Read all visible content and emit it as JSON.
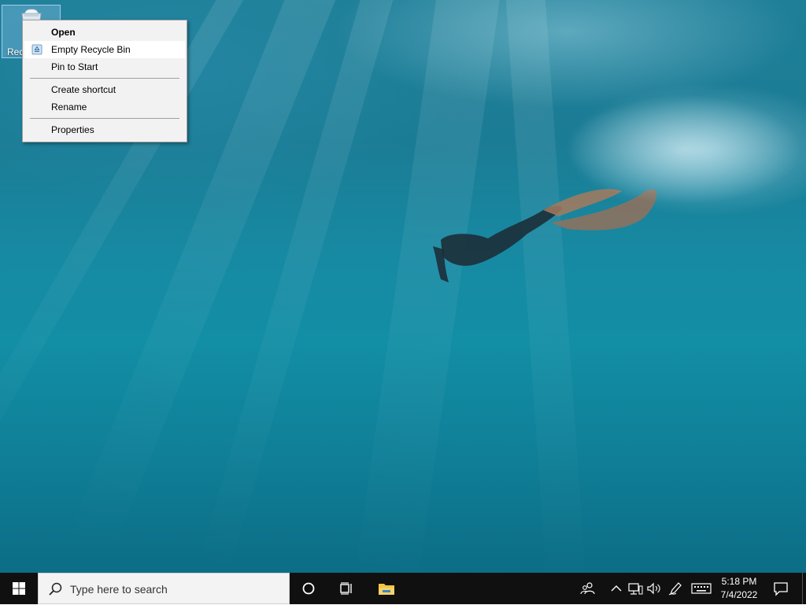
{
  "desktop": {
    "icons": [
      {
        "label": "Recycle Bin",
        "visible_label": "Rec",
        "icon": "recycle-bin-icon"
      }
    ]
  },
  "context_menu": {
    "items": [
      {
        "label": "Open",
        "bold": true
      },
      {
        "label": "Empty Recycle Bin",
        "icon": "recycle-icon",
        "highlighted": true
      },
      {
        "label": "Pin to Start"
      },
      {
        "label": "Create shortcut"
      },
      {
        "label": "Rename"
      },
      {
        "label": "Properties"
      }
    ]
  },
  "taskbar": {
    "start_icon": "windows-logo-icon",
    "search": {
      "placeholder": "Type here to search",
      "icon": "search-icon"
    },
    "buttons": [
      {
        "name": "cortana",
        "icon": "cortana-circle-icon"
      },
      {
        "name": "task-view",
        "icon": "task-view-icon"
      },
      {
        "name": "file-explorer",
        "icon": "folder-icon"
      }
    ],
    "tray": {
      "icons": [
        "people-icon",
        "chevron-up-icon",
        "network-icon",
        "volume-icon",
        "pen-icon",
        "keyboard-icon"
      ],
      "time": "5:18 PM",
      "date": "7/4/2022",
      "notification_icon": "notification-icon"
    }
  },
  "colors": {
    "taskbar": "#101010",
    "menu_bg": "#f2f2f2",
    "menu_highlight": "#ffffff",
    "folder_yellow": "#f4c542"
  }
}
